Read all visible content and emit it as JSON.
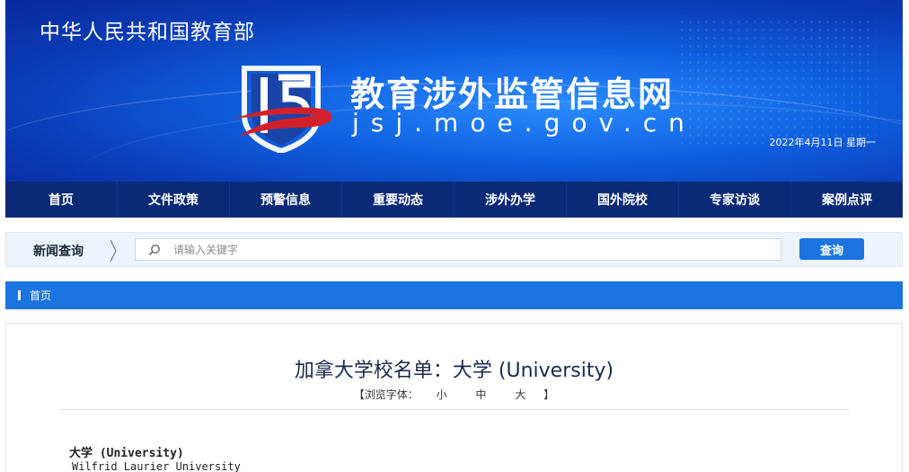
{
  "header": {
    "ministry": "中华人民共和国教育部",
    "site_title": "教育涉外监管信息网",
    "site_url": "jsj.moe.gov.cn",
    "date": "2022年4月11日 星期一",
    "brand_color": "#0f5fe0"
  },
  "nav": {
    "items": [
      {
        "label": "首页"
      },
      {
        "label": "文件政策"
      },
      {
        "label": "预警信息"
      },
      {
        "label": "重要动态"
      },
      {
        "label": "涉外办学"
      },
      {
        "label": "国外院校"
      },
      {
        "label": "专家访谈"
      },
      {
        "label": "案例点评"
      }
    ],
    "bg_color": "#0a2a78"
  },
  "search": {
    "label": "新闻查询",
    "placeholder": "请输入关键字",
    "value": "",
    "button": "查询"
  },
  "breadcrumb": {
    "home": "首页"
  },
  "article": {
    "title": "加拿大学校名单：大学 (University)",
    "font_size_prefix": "【浏览字体：",
    "font_small": "小",
    "font_medium": "中",
    "font_large": "大",
    "font_size_suffix": "】",
    "section_heading": "大学 (University)",
    "school": "Wilfrid Laurier University"
  }
}
